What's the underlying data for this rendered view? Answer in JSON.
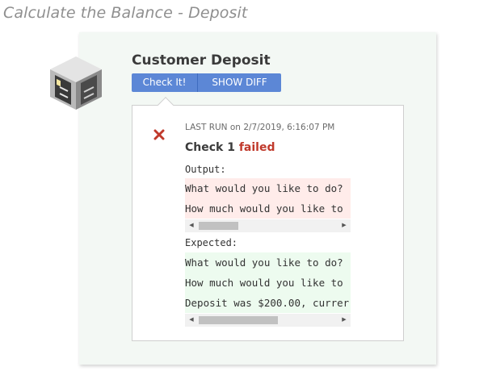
{
  "page": {
    "title": "Calculate the Balance - Deposit"
  },
  "card": {
    "title": "Customer Deposit",
    "buttons": {
      "check": "Check It!",
      "show_diff": "SHOW DIFF"
    }
  },
  "result": {
    "last_run_label": "LAST RUN",
    "last_run_on": "on",
    "last_run_time": "2/7/2019, 6:16:07 PM",
    "check_label": "Check 1",
    "status": "failed",
    "output_label": "Output:",
    "output_lines": [
      "What would you like to do?",
      "How much would you like to"
    ],
    "expected_label": "Expected:",
    "expected_lines": [
      "What would you like to do?",
      "How much would you like to",
      "Deposit was $200.00, currer"
    ]
  },
  "icons": {
    "logo": "cube-building-icon",
    "fail": "red-x-icon"
  },
  "colors": {
    "button": "#5c87d6",
    "failed": "#c0392b",
    "output_bg": "#ffecea",
    "expected_bg": "#edfbef",
    "card_bg": "#f3f8f4"
  }
}
